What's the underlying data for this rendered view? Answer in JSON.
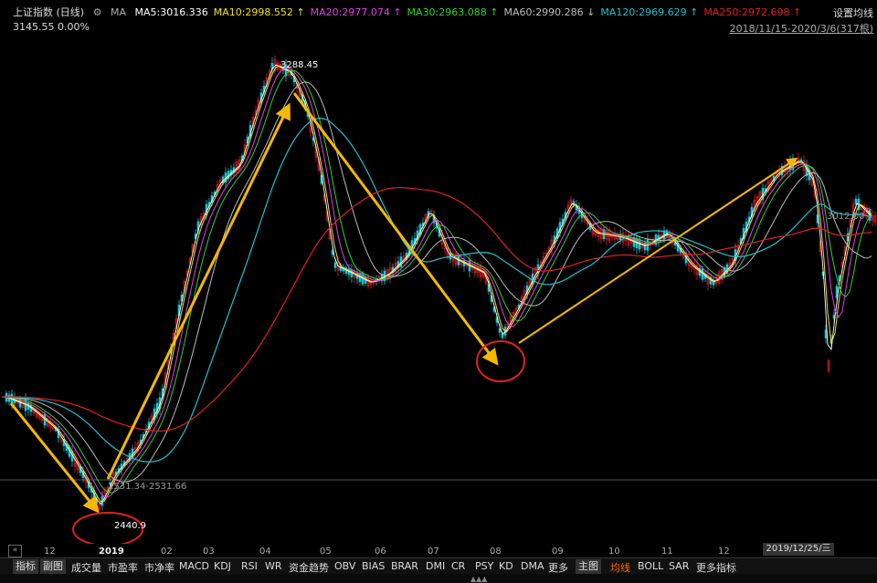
{
  "header": {
    "index_name": "上证指数 (日线)",
    "ma_label": "MA",
    "indicators": [
      {
        "text": "MA5:3016.336",
        "color": "#ffffff"
      },
      {
        "text": "MA10:2998.552 ↑",
        "color": "#f0e020"
      },
      {
        "text": "MA20:2977.074 ↑",
        "color": "#e040e0"
      },
      {
        "text": "MA30:2963.088 ↑",
        "color": "#30d030"
      },
      {
        "text": "MA60:2990.286 ↓",
        "color": "#bbbbbb"
      },
      {
        "text": "MA120:2969.629 ↑",
        "color": "#20c0d0"
      },
      {
        "text": "MA250:2972.698 ↑",
        "color": "#e02020"
      }
    ],
    "price_line": "3145.55 0.00%",
    "settings_label": "设置均线",
    "date_range": "2018/11/15-2020/3/6(317根)"
  },
  "chart": {
    "high_label": "3288.45",
    "low_label": "2440.9",
    "ref_label": "2531.34-2531.66",
    "right_label": "3012.00",
    "colors": {
      "up": "#e02020",
      "down": "#20c0d0",
      "arrow": "#f5b800",
      "circle": "#e02020"
    }
  },
  "xaxis": {
    "ticks": [
      {
        "label": "12"
      },
      {
        "label": "2019"
      },
      {
        "label": "02"
      },
      {
        "label": "03"
      },
      {
        "label": "04"
      },
      {
        "label": "05"
      },
      {
        "label": "06"
      },
      {
        "label": "07"
      },
      {
        "label": "08"
      },
      {
        "label": "09"
      },
      {
        "label": "10"
      },
      {
        "label": "11"
      },
      {
        "label": "12"
      }
    ],
    "current_date": "2019/12/25/三",
    "collapse_label": "«"
  },
  "tabs": [
    "指标",
    "副图",
    "成交量",
    "市盈率",
    "市净率",
    "MACD",
    "KDJ",
    "RSI",
    "WR",
    "资金趋势",
    "OBV",
    "BIAS",
    "BRAR",
    "DMI",
    "CR",
    "PSY",
    "KD",
    "DMA",
    "更多",
    "主图",
    "均线",
    "BOLL",
    "SAR",
    "更多指标"
  ],
  "active_tab": "均线"
}
